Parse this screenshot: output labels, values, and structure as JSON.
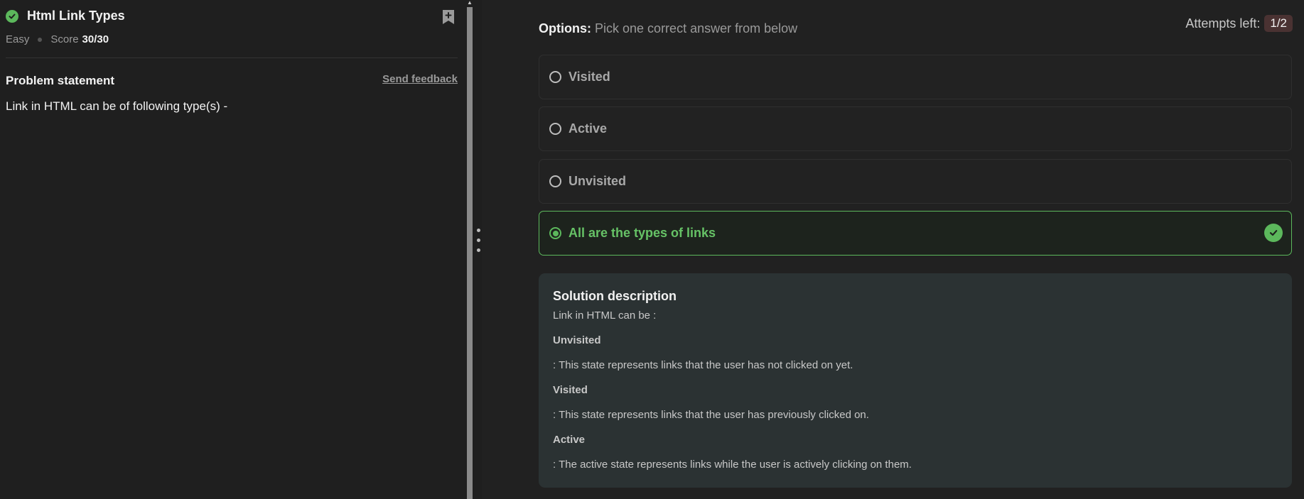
{
  "problem": {
    "title": "Html Link Types",
    "difficulty": "Easy",
    "score_label": "Score",
    "score_value": "30/30",
    "statement_heading": "Problem statement",
    "feedback_link": "Send feedback",
    "statement_text": "Link in HTML can be of following type(s) -"
  },
  "options_panel": {
    "heading_bold": "Options:",
    "heading_rest": "Pick one correct answer from below",
    "attempts_label": "Attempts left:",
    "attempts_value": "1/2",
    "options": [
      {
        "label": "Visited",
        "selected": false
      },
      {
        "label": "Active",
        "selected": false
      },
      {
        "label": "Unvisited",
        "selected": false
      },
      {
        "label": "All are the types of links",
        "selected": true,
        "correct": true
      }
    ]
  },
  "solution": {
    "heading": "Solution description",
    "lines": [
      {
        "text": "Link in HTML can be :",
        "bold": false
      },
      {
        "text": "Unvisited",
        "bold": true
      },
      {
        "text": ": This state represents links that the user has not clicked on yet.",
        "bold": false
      },
      {
        "text": "Visited",
        "bold": true
      },
      {
        "text": ": This state represents links that the user has previously clicked on.",
        "bold": false
      },
      {
        "text": "Active",
        "bold": true
      },
      {
        "text": ": The active state represents links while the user is actively clicking on them.",
        "bold": false
      }
    ]
  },
  "colors": {
    "success": "#5cb85c",
    "background": "#1f1f1f",
    "solution_bg": "#2b3233",
    "attempts_badge": "#4a3232"
  },
  "icons": {
    "solved": "check-circle-icon",
    "bookmark": "bookmark-add-icon",
    "correct": "check-circle-icon",
    "splitter": "drag-handle-icon"
  }
}
